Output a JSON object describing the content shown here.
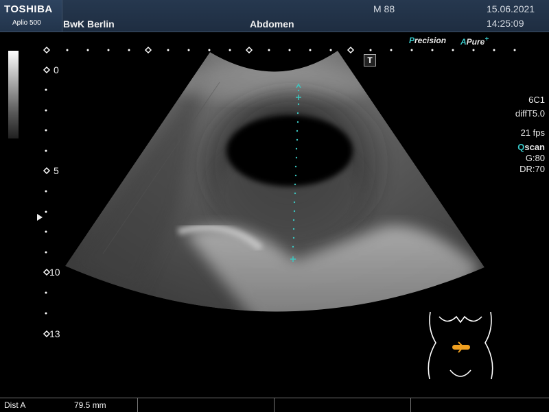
{
  "header": {
    "brand": "TOSHIBA",
    "model": "Aplio 500",
    "site": "BwK Berlin",
    "exam": "Abdomen",
    "patient_id": "M 88",
    "date": "15.06.2021",
    "time": "14:25:09"
  },
  "modes": {
    "precision_cap": "P",
    "precision_rest": "recision",
    "apure_cap": "A",
    "apure_rest": "Pure",
    "apure_suffix": "+",
    "t_badge": "T"
  },
  "depth_scale": {
    "labels": [
      "0",
      "5",
      "10",
      "13"
    ]
  },
  "right_info": {
    "probe": "6C1",
    "preset": "diffT5.0",
    "fps": "21 fps",
    "qscan_cap": "Q",
    "qscan_rest": "scan",
    "gain": "G:80",
    "dr": "DR:70"
  },
  "measurement": {
    "label": "Dist  A",
    "value": "79.5 mm"
  },
  "colors": {
    "accent_cyan": "#38c8c8",
    "caliper": "#3cc6c0",
    "marker_orange": "#f0a020"
  }
}
